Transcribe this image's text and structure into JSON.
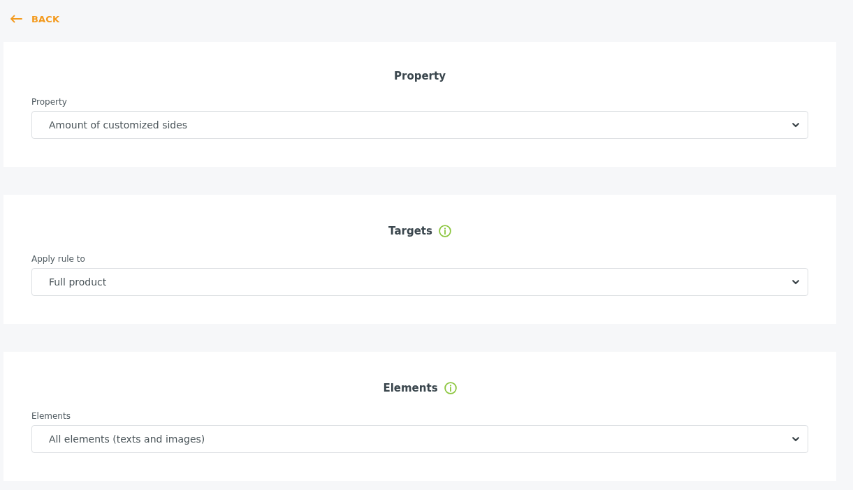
{
  "back_link": {
    "label": "BACK"
  },
  "sections": [
    {
      "title": "Property",
      "info": false,
      "field": {
        "label": "Property",
        "value": "Amount of customized sides"
      }
    },
    {
      "title": "Targets",
      "info": true,
      "field": {
        "label": "Apply rule to",
        "value": "Full product"
      }
    },
    {
      "title": "Elements",
      "info": true,
      "field": {
        "label": "Elements",
        "value": "All elements (texts and images)"
      }
    }
  ]
}
